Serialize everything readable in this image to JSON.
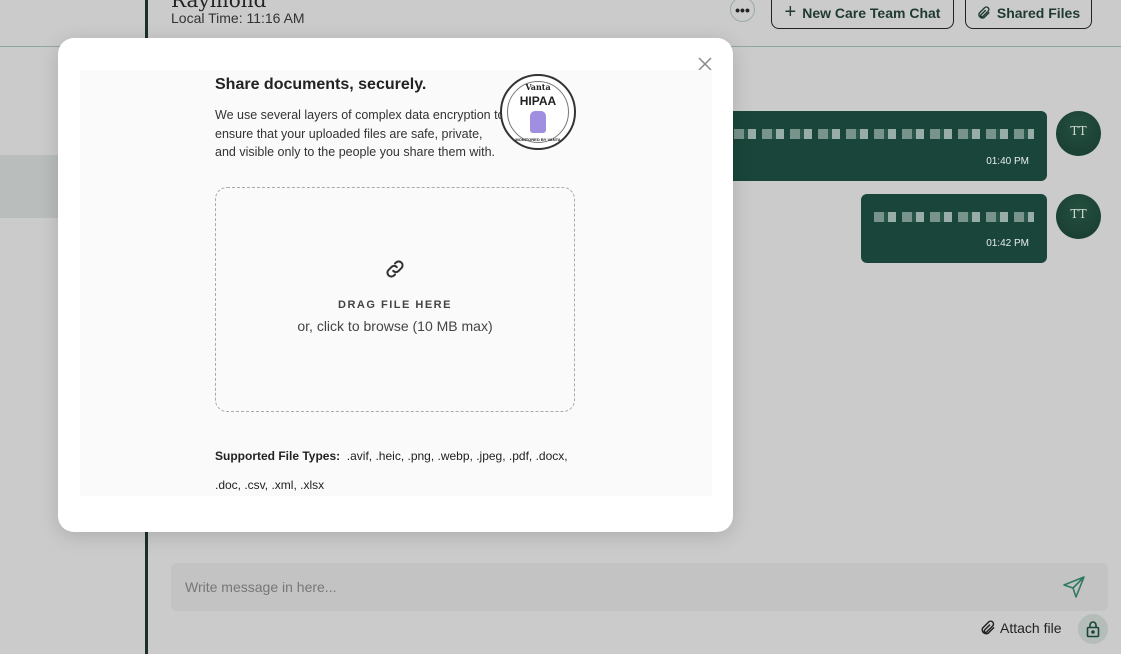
{
  "header": {
    "contact_name": "Raymond",
    "local_time": "Local Time: 11:16 AM",
    "new_chat_label": "New Care Team Chat",
    "shared_files_label": "Shared Files"
  },
  "messages": [
    {
      "time": "01:40 PM",
      "avatar": "TT"
    },
    {
      "time": "01:42 PM",
      "avatar": "TT"
    }
  ],
  "composer": {
    "placeholder": "Write message in here...",
    "attach_label": "Attach file"
  },
  "modal": {
    "title": "Share documents, securely.",
    "description": "We use several layers of complex data encryption to ensure that your uploaded files are safe, private, and visible only to the people you share them with.",
    "badge": {
      "brand": "Vanta",
      "label": "HIPAA",
      "caption": "MONITORED BY VANTA"
    },
    "dropzone": {
      "title": "DRAG FILE HERE",
      "subtitle": "or, click to browse (10 MB max)"
    },
    "supported_label": "Supported File Types:",
    "supported_types": ".avif, .heic, .png, .webp, .jpeg, .pdf, .docx, .doc, .csv, .xml, .xlsx"
  },
  "colors": {
    "accent": "#1a453a",
    "backdrop": "#cbcbcb"
  }
}
